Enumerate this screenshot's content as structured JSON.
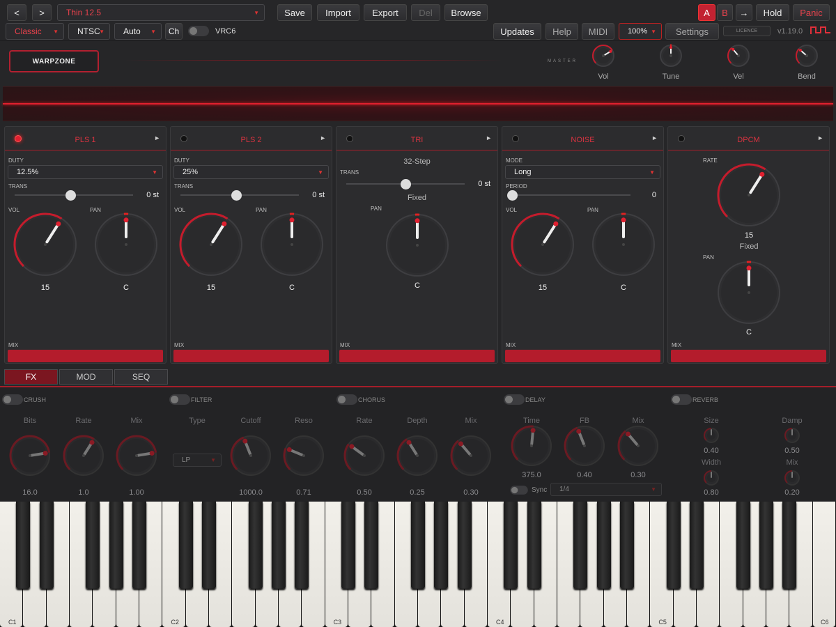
{
  "topbar": {
    "nav_back": "<",
    "nav_fwd": ">",
    "preset": "Thin 12.5",
    "save": "Save",
    "import": "Import",
    "export": "Export",
    "del": "Del",
    "browse": "Browse",
    "a": "A",
    "b": "B",
    "copy": "→",
    "hold": "Hold",
    "panic": "Panic"
  },
  "secondbar": {
    "style": "Classic",
    "tv": "NTSC",
    "auto": "Auto",
    "ch": "Ch",
    "chip": "VRC6",
    "updates": "Updates",
    "help": "Help",
    "midi": "MIDI",
    "zoom": "100%",
    "settings": "Settings",
    "licence": "LICENCE",
    "version": "v1.19.0"
  },
  "header": {
    "name": "WARPZONE",
    "master": "MASTER"
  },
  "master_knobs": [
    {
      "label": "Vol",
      "value": 0.72
    },
    {
      "label": "Tune",
      "value": 0.5
    },
    {
      "label": "Vel",
      "value": 0.35
    },
    {
      "label": "Bend",
      "value": 0.32
    }
  ],
  "panels": [
    {
      "title": "PLS 1",
      "led_on": true,
      "duty_label": "DUTY",
      "duty": "12.5%",
      "trans_label": "TRANS",
      "trans": "0 st",
      "vol_label": "VOL",
      "vol": "15",
      "vol_norm": 0.62,
      "pan_label": "PAN",
      "pan": "C",
      "mix": "MIX"
    },
    {
      "title": "PLS 2",
      "led_on": false,
      "duty_label": "DUTY",
      "duty": "25%",
      "trans_label": "TRANS",
      "trans": "0 st",
      "vol_label": "VOL",
      "vol": "15",
      "vol_norm": 0.62,
      "pan_label": "PAN",
      "pan": "C",
      "mix": "MIX"
    },
    {
      "title": "TRI",
      "led_on": false,
      "steps": "32-Step",
      "trans_label": "TRANS",
      "trans": "0 st",
      "fixed": "Fixed",
      "pan_label": "PAN",
      "pan": "C",
      "mix": "MIX"
    },
    {
      "title": "NOISE",
      "led_on": false,
      "mode_label": "MODE",
      "mode": "Long",
      "period_label": "PERIOD",
      "period": "0",
      "vol_label": "VOL",
      "vol": "15",
      "vol_norm": 0.62,
      "pan_label": "PAN",
      "pan": "C",
      "mix": "MIX"
    },
    {
      "title": "DPCM",
      "led_on": false,
      "rate_label": "RATE",
      "rate": "15",
      "rate_norm": 0.62,
      "fixed": "Fixed",
      "pan_label": "PAN",
      "pan": "C",
      "mix": "MIX"
    }
  ],
  "tabs": [
    "FX",
    "MOD",
    "SEQ"
  ],
  "fx": {
    "crush": {
      "name": "CRUSH",
      "knobs": [
        {
          "label": "Bits",
          "value": "16.0",
          "norm": 0.8
        },
        {
          "label": "Rate",
          "value": "1.0",
          "norm": 0.62
        },
        {
          "label": "Mix",
          "value": "1.00",
          "norm": 0.8
        }
      ]
    },
    "filter": {
      "name": "FILTER",
      "type_label": "Type",
      "type": "LP",
      "knobs": [
        {
          "label": "Cutoff",
          "value": "1000.0",
          "norm": 0.42
        },
        {
          "label": "Reso",
          "value": "0.71",
          "norm": 0.25
        }
      ]
    },
    "chorus": {
      "name": "CHORUS",
      "knobs": [
        {
          "label": "Rate",
          "value": "0.50",
          "norm": 0.3
        },
        {
          "label": "Depth",
          "value": "0.25",
          "norm": 0.38
        },
        {
          "label": "Mix",
          "value": "0.30",
          "norm": 0.35
        }
      ]
    },
    "delay": {
      "name": "DELAY",
      "knobs": [
        {
          "label": "Time",
          "value": "375.0",
          "norm": 0.52
        },
        {
          "label": "FB",
          "value": "0.40",
          "norm": 0.42
        },
        {
          "label": "Mix",
          "value": "0.30",
          "norm": 0.35
        }
      ],
      "sync": "Sync",
      "div": "1/4"
    },
    "reverb": {
      "name": "REVERB",
      "knobs": [
        {
          "label": "Size",
          "value": "0.40"
        },
        {
          "label": "Damp",
          "value": "0.50"
        },
        {
          "label": "Width",
          "value": "0.80"
        },
        {
          "label": "Mix",
          "value": "0.20"
        }
      ]
    }
  },
  "keyboard": {
    "octaves": [
      "C1",
      "C2",
      "C3",
      "C4",
      "C5",
      "C6"
    ]
  },
  "colors": {
    "accent": "#e02030",
    "mix_bar": "#b41c2c",
    "panel": "#2c2c2e"
  }
}
